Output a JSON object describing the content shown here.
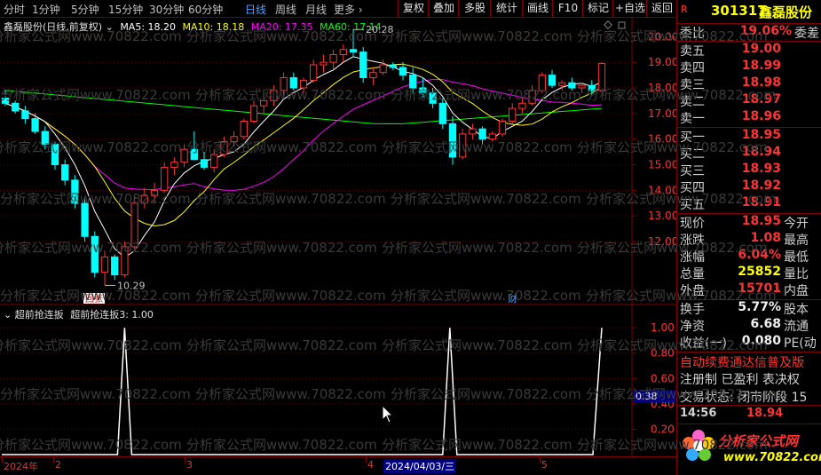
{
  "toolbar": {
    "periods": [
      "分时",
      "1分钟",
      "5分钟",
      "15分钟",
      "30分钟",
      "60分钟",
      "日线",
      "周线",
      "月线",
      "更多"
    ],
    "active_period": "日线",
    "buttons": [
      "复权",
      "叠加",
      "多股",
      "统计",
      "画线",
      "F10",
      "标记",
      "+自选",
      "返回"
    ]
  },
  "legend": {
    "title": "鑫磊股份(日线,前复权)",
    "ma5": "MA5: 18.20",
    "ma10": "MA10: 18.18",
    "ma20": "MA20: 17.35",
    "ma60": "MA60: 17.14"
  },
  "indicator_legend": {
    "name": "超前抢连扳",
    "value": "超前抢连扳3: 1.00"
  },
  "annotations": {
    "high": "20.28",
    "low": "10.29",
    "tag_zhang": "回张",
    "tag_cai": "财"
  },
  "watermark": "分析家公式网www.70822.com",
  "colors": {
    "up": "#ff3333",
    "down": "#00ffff",
    "ma5": "#ffffff",
    "ma10": "#ffff00",
    "ma20": "#ff00ff",
    "ma60": "#00ff00",
    "grid": "#800000"
  },
  "time_axis": {
    "labels": [
      "2024年",
      "2",
      "3",
      "4",
      "2024/04/03/三",
      "5"
    ]
  },
  "chart_data": [
    {
      "type": "candlestick",
      "ylim": [
        10.2,
        20.6
      ],
      "yticks": [
        "20.00",
        "19.00",
        "18.00",
        "17.00",
        "16.00",
        "15.00",
        "14.00",
        "13.00",
        "12.00"
      ],
      "ytick_values": [
        20,
        19,
        18,
        17,
        16,
        15,
        14,
        13,
        12
      ],
      "candles": [
        [
          17.6,
          17.9,
          17.3,
          17.4
        ],
        [
          17.4,
          17.5,
          17.0,
          17.1
        ],
        [
          17.1,
          17.3,
          16.6,
          16.8
        ],
        [
          16.8,
          17.0,
          16.2,
          16.3
        ],
        [
          16.3,
          16.5,
          15.6,
          15.8
        ],
        [
          15.8,
          15.9,
          14.8,
          15.0
        ],
        [
          15.0,
          15.2,
          14.2,
          14.4
        ],
        [
          14.4,
          14.6,
          13.3,
          13.5
        ],
        [
          13.5,
          13.7,
          12.0,
          12.2
        ],
        [
          12.2,
          12.4,
          10.6,
          10.8
        ],
        [
          10.8,
          11.6,
          10.3,
          11.4
        ],
        [
          11.4,
          11.5,
          10.5,
          10.7
        ],
        [
          10.7,
          12.0,
          10.6,
          11.8
        ],
        [
          11.8,
          13.8,
          11.7,
          13.5
        ],
        [
          13.5,
          14.1,
          13.3,
          13.8
        ],
        [
          13.8,
          14.3,
          13.5,
          14.0
        ],
        [
          14.0,
          15.1,
          13.9,
          14.9
        ],
        [
          14.9,
          15.3,
          14.6,
          15.1
        ],
        [
          15.1,
          15.8,
          14.9,
          15.6
        ],
        [
          15.6,
          16.3,
          15.4,
          15.2
        ],
        [
          15.2,
          15.5,
          14.8,
          14.9
        ],
        [
          14.9,
          15.6,
          14.7,
          15.4
        ],
        [
          15.4,
          16.1,
          15.3,
          15.9
        ],
        [
          15.9,
          16.3,
          15.7,
          16.1
        ],
        [
          16.1,
          16.8,
          16.0,
          16.7
        ],
        [
          16.7,
          17.5,
          16.6,
          17.3
        ],
        [
          17.3,
          17.8,
          17.0,
          17.5
        ],
        [
          17.5,
          18.1,
          17.3,
          17.9
        ],
        [
          17.9,
          18.6,
          17.7,
          18.4
        ],
        [
          18.4,
          18.6,
          17.9,
          18.0
        ],
        [
          18.0,
          18.4,
          17.8,
          18.3
        ],
        [
          18.3,
          19.1,
          18.2,
          18.9
        ],
        [
          18.9,
          19.3,
          18.6,
          19.0
        ],
        [
          19.0,
          19.5,
          18.7,
          19.3
        ],
        [
          19.3,
          19.7,
          19.0,
          19.5
        ],
        [
          19.5,
          20.28,
          19.2,
          19.4
        ],
        [
          19.4,
          19.6,
          18.2,
          18.4
        ],
        [
          18.4,
          18.8,
          18.1,
          18.6
        ],
        [
          18.6,
          19.1,
          18.5,
          18.9
        ],
        [
          18.9,
          19.0,
          18.7,
          18.8
        ],
        [
          18.8,
          19.0,
          18.3,
          18.5
        ],
        [
          18.5,
          18.8,
          17.8,
          18.0
        ],
        [
          18.0,
          18.4,
          17.6,
          17.8
        ],
        [
          17.8,
          18.0,
          17.2,
          17.4
        ],
        [
          17.4,
          17.6,
          16.4,
          16.6
        ],
        [
          16.6,
          16.9,
          15.0,
          15.3
        ],
        [
          15.3,
          16.4,
          15.2,
          16.2
        ],
        [
          16.2,
          16.6,
          16.0,
          16.4
        ],
        [
          16.4,
          16.5,
          15.8,
          16.0
        ],
        [
          16.0,
          16.3,
          15.9,
          16.2
        ],
        [
          16.2,
          16.8,
          16.1,
          16.7
        ],
        [
          16.7,
          17.4,
          16.6,
          17.2
        ],
        [
          17.2,
          17.6,
          17.0,
          17.4
        ],
        [
          17.4,
          18.1,
          17.3,
          17.9
        ],
        [
          17.9,
          18.6,
          17.8,
          18.5
        ],
        [
          18.5,
          18.7,
          18.0,
          18.1
        ],
        [
          18.1,
          18.3,
          17.9,
          18.2
        ],
        [
          18.2,
          18.4,
          17.9,
          18.0
        ],
        [
          18.0,
          18.2,
          17.8,
          18.1
        ],
        [
          18.1,
          18.3,
          17.7,
          17.9
        ],
        [
          17.9,
          19.0,
          17.9,
          18.95
        ]
      ]
    },
    {
      "type": "line",
      "ylim": [
        0,
        1.05
      ],
      "yticks": [
        "1.00",
        "0.80",
        "0.60",
        "0.40",
        "0.20"
      ],
      "ytick_values": [
        1.0,
        0.8,
        0.6,
        0.4,
        0.2
      ],
      "current": "0.38",
      "series": [
        {
          "spikes_at": [
            12,
            44,
            60
          ]
        }
      ]
    }
  ],
  "quote": {
    "code": "301317",
    "name": "鑫磊股份",
    "weibi_label": "委比",
    "weibi": "19.06%",
    "weicha_label": "委差",
    "asks": [
      [
        "卖五",
        "19.00"
      ],
      [
        "卖四",
        "18.99"
      ],
      [
        "卖三",
        "18.98"
      ],
      [
        "卖二",
        "18.97"
      ],
      [
        "卖一",
        "18.96"
      ]
    ],
    "bids": [
      [
        "买一",
        "18.95"
      ],
      [
        "买二",
        "18.94"
      ],
      [
        "买三",
        "18.93"
      ],
      [
        "买四",
        "18.92"
      ],
      [
        "买五",
        "18.91"
      ]
    ],
    "stats": [
      [
        "现价",
        "18.95",
        "今开"
      ],
      [
        "涨跌",
        "1.08",
        "最高"
      ],
      [
        "涨幅",
        "6.04%",
        "最低"
      ],
      [
        "总量",
        "25852",
        "量比"
      ],
      [
        "外盘",
        "15701",
        "内盘"
      ]
    ],
    "stats2": [
      [
        "换手",
        "5.77%",
        "股本"
      ],
      [
        "净资",
        "6.68",
        "流通"
      ],
      [
        "收益(一)",
        "0.080",
        "PE(动"
      ]
    ],
    "scroll_text": "自动续费通达信普及版",
    "reg_text": "注册制 已盈利 表决权",
    "status": "交易状态: 闭市阶段 15",
    "tick_time": "14:56",
    "tick_price": "18.94",
    "brand": "分析家公式网",
    "brand_url": "www.70822.com"
  }
}
